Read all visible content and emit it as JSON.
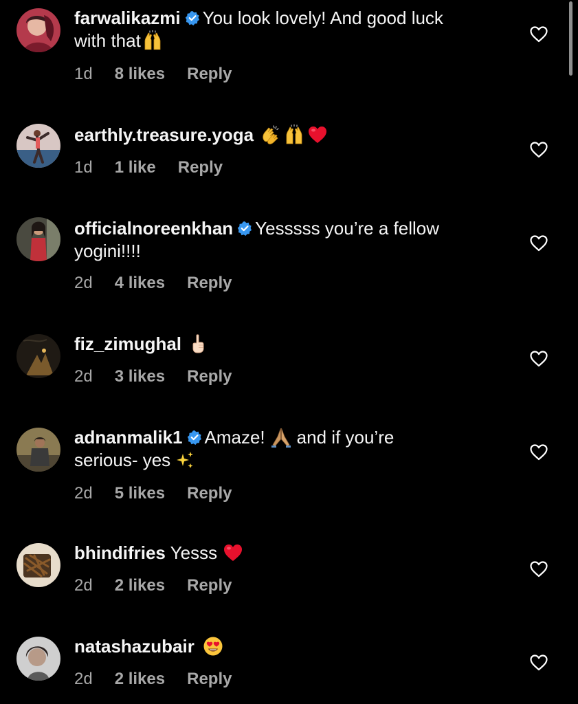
{
  "comments": [
    {
      "username": "farwalikazmi",
      "verified": true,
      "text_line1": "You look lovely! And good luck",
      "text_line2": "with that",
      "emojis_after": [
        "raising-hands"
      ],
      "time": "1d",
      "likes": "8 likes",
      "reply": "Reply"
    },
    {
      "username": "earthly.treasure.yoga",
      "verified": false,
      "text_line1": "",
      "emojis_after": [
        "clapping-hands",
        "raising-hands",
        "red-heart"
      ],
      "time": "1d",
      "likes": "1 like",
      "reply": "Reply"
    },
    {
      "username": "officialnoreenkhan",
      "verified": true,
      "text_line1": "Yesssss you’re a fellow",
      "text_line2": "yogini!!!!",
      "time": "2d",
      "likes": "4 likes",
      "reply": "Reply"
    },
    {
      "username": "fiz_zimughal",
      "verified": false,
      "text_line1": "",
      "emojis_after": [
        "index-pointing-up"
      ],
      "time": "2d",
      "likes": "3 likes",
      "reply": "Reply"
    },
    {
      "username": "adnanmalik1",
      "verified": true,
      "text_line1_a": "Amaze!",
      "text_line1_b": "and if you’re",
      "text_line2": "serious- yes",
      "emojis": [
        "folded-hands",
        "sparkles"
      ],
      "time": "2d",
      "likes": "5 likes",
      "reply": "Reply"
    },
    {
      "username": "bhindifries",
      "verified": false,
      "text_line1": "Yesss",
      "emojis_after": [
        "red-heart"
      ],
      "time": "2d",
      "likes": "2 likes",
      "reply": "Reply"
    },
    {
      "username": "natashazubair",
      "verified": false,
      "text_line1": "",
      "emojis_after": [
        "heart-eyes-face"
      ],
      "time": "2d",
      "likes": "2 likes",
      "reply": "Reply"
    }
  ],
  "icons": {
    "like": "heart-outline-icon",
    "verified": "verified-badge-icon"
  },
  "colors": {
    "background": "#000000",
    "primary_text": "#f5f5f5",
    "secondary_text": "#a8a8a8",
    "verified_blue": "#3897f0",
    "heart_red": "#e0245e"
  }
}
